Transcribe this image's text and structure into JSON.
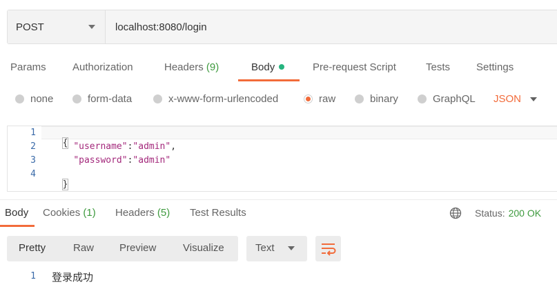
{
  "request": {
    "method": "POST",
    "url": "localhost:8080/login"
  },
  "request_tabs": [
    {
      "label": "Params"
    },
    {
      "label": "Authorization"
    },
    {
      "label": "Headers",
      "count": "(9)"
    },
    {
      "label": "Body"
    },
    {
      "label": "Pre-request Script"
    },
    {
      "label": "Tests"
    },
    {
      "label": "Settings"
    }
  ],
  "body_types": [
    {
      "label": "none"
    },
    {
      "label": "form-data"
    },
    {
      "label": "x-www-form-urlencoded"
    },
    {
      "label": "raw"
    },
    {
      "label": "binary"
    },
    {
      "label": "GraphQL"
    }
  ],
  "format": "JSON",
  "editor": {
    "line_numbers": [
      "1",
      "2",
      "3",
      "4"
    ],
    "line1_open": "{",
    "line2_key": "\"username\"",
    "line2_colon": ":",
    "line2_value": "\"admin\"",
    "line2_comma": ",",
    "line3_key": "\"password\"",
    "line3_colon": ":",
    "line3_value": "\"admin\"",
    "line4_close": "}"
  },
  "response_tabs": [
    {
      "label": "Body"
    },
    {
      "label": "Cookies",
      "count": "(1)"
    },
    {
      "label": "Headers",
      "count": "(5)"
    },
    {
      "label": "Test Results"
    }
  ],
  "status": {
    "label": "Status:",
    "value": "200 OK"
  },
  "view_modes": [
    "Pretty",
    "Raw",
    "Preview",
    "Visualize"
  ],
  "text_format": "Text",
  "response": {
    "line_number": "1",
    "text": "登录成功"
  },
  "colors": {
    "accent": "#f26b3a",
    "success": "#3e9a3e",
    "line_number": "#3a6aa8",
    "string": "#a3287b"
  }
}
